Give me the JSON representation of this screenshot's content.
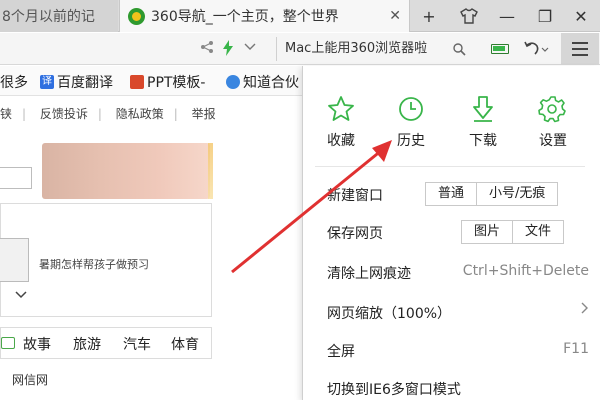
{
  "tabs": [
    {
      "label": "8个月以前的记"
    },
    {
      "label": "360导航_一个主页，整个世界"
    }
  ],
  "tab_controls": {
    "new_tab": "+",
    "close_tab": "✕"
  },
  "window_controls": {
    "minimize": "—",
    "maximize": "❐",
    "close": "✕"
  },
  "address_bar": {
    "search_text": "Mac上能用360浏览器啦"
  },
  "bookmarks": [
    {
      "label": "很多"
    },
    {
      "label": "百度翻译",
      "icon_text": "译"
    },
    {
      "label": "PPT模板-"
    },
    {
      "label": "知道合伙"
    }
  ],
  "page": {
    "links": [
      "铗",
      "反馈投诉",
      "隐私政策",
      "举报"
    ],
    "caption": "暑期怎样帮孩子做预习",
    "categories": [
      "故事",
      "旅游",
      "汽车",
      "体育"
    ],
    "footer": "网信网"
  },
  "menu": {
    "quick_actions": [
      {
        "label": "收藏",
        "icon": "star-icon"
      },
      {
        "label": "历史",
        "icon": "clock-icon"
      },
      {
        "label": "下载",
        "icon": "download-icon"
      },
      {
        "label": "设置",
        "icon": "gear-icon"
      }
    ],
    "new_window": {
      "label": "新建窗口",
      "options": [
        "普通",
        "小号/无痕"
      ]
    },
    "save_page": {
      "label": "保存网页",
      "options": [
        "图片",
        "文件"
      ]
    },
    "clear_traces": {
      "label": "清除上网痕迹",
      "shortcut": "Ctrl+Shift+Delete"
    },
    "zoom": {
      "label": "网页缩放（100%）"
    },
    "fullscreen": {
      "label": "全屏",
      "shortcut": "F11"
    },
    "ie6_mode": {
      "label": "切换到IE6多窗口模式"
    }
  },
  "colors": {
    "accent_green": "#39b54a",
    "annotation_red": "#e03131",
    "menu_button_bg": "#d6d6d6"
  }
}
